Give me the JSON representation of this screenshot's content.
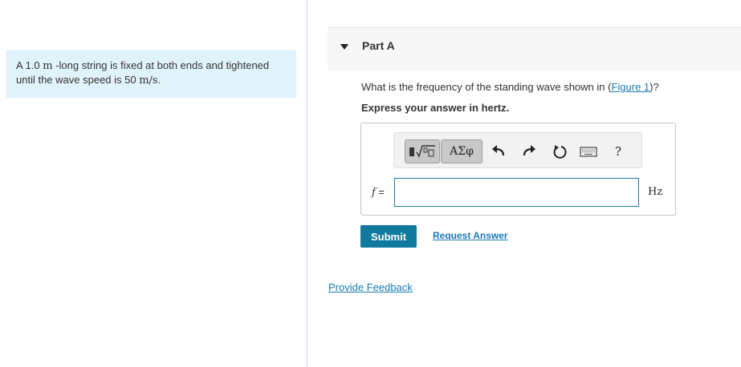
{
  "problem": {
    "text_1": "A 1.0 ",
    "unit_length": "m",
    "text_2": " -long string is fixed at both ends and tightened until the wave speed is 50 ",
    "unit_speed": "m/s",
    "text_3": "."
  },
  "part": {
    "title": "Part A",
    "question_before": "What is the frequency of the standing wave shown in (",
    "figure_link": "Figure 1",
    "question_after": ")?",
    "instruction": "Express your answer in hertz."
  },
  "toolbar": {
    "templates_icon": "radical-template-icon",
    "greek_label": "ΑΣφ",
    "undo_icon": "undo-icon",
    "redo_icon": "redo-icon",
    "reset_icon": "reset-icon",
    "keyboard_icon": "keyboard-icon",
    "help_label": "?"
  },
  "answer": {
    "variable": "f",
    "equals": " =",
    "value": "",
    "unit": "Hz"
  },
  "actions": {
    "submit_label": "Submit",
    "request_label": "Request Answer",
    "feedback_label": "Provide Feedback"
  },
  "colors": {
    "problem_background": "#e1f3fa",
    "link": "#1a7bb3",
    "submit_background": "#0f7a9e",
    "input_border": "#1a7bb3"
  }
}
